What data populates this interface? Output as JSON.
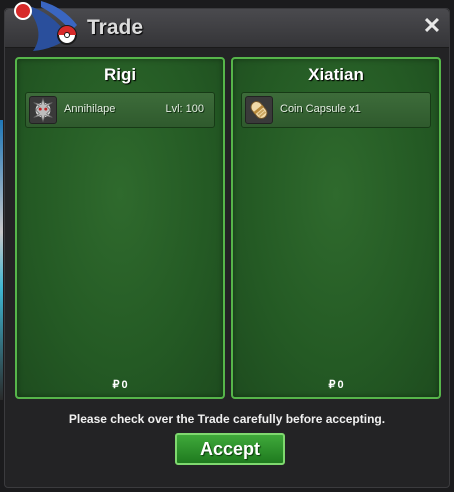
{
  "window": {
    "title": "Trade",
    "close_glyph": "✕"
  },
  "panels": [
    {
      "player": "Rigi",
      "items": [
        {
          "name": "Annihilape",
          "level": "Lvl: 100",
          "icon": "annihilape-icon"
        }
      ],
      "money_symbol": "₽",
      "money": "0"
    },
    {
      "player": "Xiatian",
      "items": [
        {
          "name": "Coin Capsule  x1",
          "level": "",
          "icon": "coin-capsule-icon"
        }
      ],
      "money_symbol": "₽",
      "money": "0"
    }
  ],
  "footer": {
    "notice": "Please check over the Trade carefully before accepting.",
    "accept_label": "Accept"
  },
  "colors": {
    "panel_green": "#245a24",
    "panel_border": "#56b54a",
    "accept_green": "#2f8f2c"
  }
}
